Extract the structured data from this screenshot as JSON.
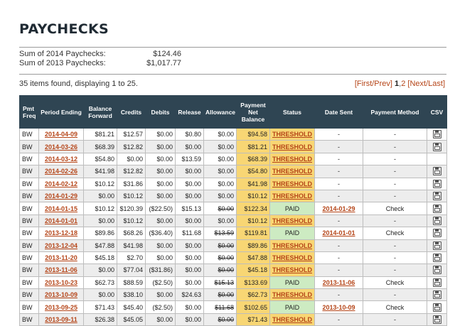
{
  "page_title": "PAYCHECKS",
  "sums": [
    {
      "label": "Sum of 2014 Paychecks:",
      "value": "$124.46"
    },
    {
      "label": "Sum of 2013 Paychecks:",
      "value": "$1,017.77"
    }
  ],
  "found_text": "35 items found, displaying 1 to 25.",
  "pager": {
    "first_prev": "[First/Prev]",
    "current": "1",
    "sep": ",",
    "page2": "2",
    "next_last": "[Next/Last]"
  },
  "columns": [
    "Pmt Freq",
    "Period Ending",
    "Balance Forward",
    "Credits",
    "Debits",
    "Release",
    "Allowance",
    "Payment Net Balance",
    "Status",
    "Date Sent",
    "Payment Method",
    "CSV"
  ],
  "rows": [
    {
      "freq": "BW",
      "period": "2014-04-09",
      "balance": "$81.21",
      "credits": "$12.57",
      "debits": "$0.00",
      "release": "$0.80",
      "allowance": "$0.00",
      "allow_strike": false,
      "net": "$94.58",
      "status": "THRESHOLD",
      "sent": "-",
      "sent_link": false,
      "method": "-",
      "csv": true
    },
    {
      "freq": "BW",
      "period": "2014-03-26",
      "balance": "$68.39",
      "credits": "$12.82",
      "debits": "$0.00",
      "release": "$0.00",
      "allowance": "$0.00",
      "allow_strike": false,
      "net": "$81.21",
      "status": "THRESHOLD",
      "sent": "-",
      "sent_link": false,
      "method": "-",
      "csv": true
    },
    {
      "freq": "BW",
      "period": "2014-03-12",
      "balance": "$54.80",
      "credits": "$0.00",
      "debits": "$0.00",
      "release": "$13.59",
      "allowance": "$0.00",
      "allow_strike": false,
      "net": "$68.39",
      "status": "THRESHOLD",
      "sent": "-",
      "sent_link": false,
      "method": "-",
      "csv": false
    },
    {
      "freq": "BW",
      "period": "2014-02-26",
      "balance": "$41.98",
      "credits": "$12.82",
      "debits": "$0.00",
      "release": "$0.00",
      "allowance": "$0.00",
      "allow_strike": false,
      "net": "$54.80",
      "status": "THRESHOLD",
      "sent": "-",
      "sent_link": false,
      "method": "-",
      "csv": true
    },
    {
      "freq": "BW",
      "period": "2014-02-12",
      "balance": "$10.12",
      "credits": "$31.86",
      "debits": "$0.00",
      "release": "$0.00",
      "allowance": "$0.00",
      "allow_strike": false,
      "net": "$41.98",
      "status": "THRESHOLD",
      "sent": "-",
      "sent_link": false,
      "method": "-",
      "csv": true
    },
    {
      "freq": "BW",
      "period": "2014-01-29",
      "balance": "$0.00",
      "credits": "$10.12",
      "debits": "$0.00",
      "release": "$0.00",
      "allowance": "$0.00",
      "allow_strike": false,
      "net": "$10.12",
      "status": "THRESHOLD",
      "sent": "-",
      "sent_link": false,
      "method": "-",
      "csv": true
    },
    {
      "freq": "BW",
      "period": "2014-01-15",
      "balance": "$10.12",
      "credits": "$120.39",
      "debits": "($22.50)",
      "release": "$15.13",
      "allowance": "$0.00",
      "allow_strike": true,
      "net": "$122.34",
      "status": "PAID",
      "sent": "2014-01-29",
      "sent_link": true,
      "method": "Check",
      "csv": true
    },
    {
      "freq": "BW",
      "period": "2014-01-01",
      "balance": "$0.00",
      "credits": "$10.12",
      "debits": "$0.00",
      "release": "$0.00",
      "allowance": "$0.00",
      "allow_strike": false,
      "net": "$10.12",
      "status": "THRESHOLD",
      "sent": "-",
      "sent_link": false,
      "method": "-",
      "csv": true
    },
    {
      "freq": "BW",
      "period": "2013-12-18",
      "balance": "$89.86",
      "credits": "$68.26",
      "debits": "($36.40)",
      "release": "$11.68",
      "allowance": "$13.59",
      "allow_strike": true,
      "net": "$119.81",
      "status": "PAID",
      "sent": "2014-01-01",
      "sent_link": true,
      "method": "Check",
      "csv": true
    },
    {
      "freq": "BW",
      "period": "2013-12-04",
      "balance": "$47.88",
      "credits": "$41.98",
      "debits": "$0.00",
      "release": "$0.00",
      "allowance": "$0.00",
      "allow_strike": true,
      "net": "$89.86",
      "status": "THRESHOLD",
      "sent": "-",
      "sent_link": false,
      "method": "-",
      "csv": true
    },
    {
      "freq": "BW",
      "period": "2013-11-20",
      "balance": "$45.18",
      "credits": "$2.70",
      "debits": "$0.00",
      "release": "$0.00",
      "allowance": "$0.00",
      "allow_strike": true,
      "net": "$47.88",
      "status": "THRESHOLD",
      "sent": "-",
      "sent_link": false,
      "method": "-",
      "csv": true
    },
    {
      "freq": "BW",
      "period": "2013-11-06",
      "balance": "$0.00",
      "credits": "$77.04",
      "debits": "($31.86)",
      "release": "$0.00",
      "allowance": "$0.00",
      "allow_strike": true,
      "net": "$45.18",
      "status": "THRESHOLD",
      "sent": "-",
      "sent_link": false,
      "method": "-",
      "csv": true
    },
    {
      "freq": "BW",
      "period": "2013-10-23",
      "balance": "$62.73",
      "credits": "$88.59",
      "debits": "($2.50)",
      "release": "$0.00",
      "allowance": "$15.13",
      "allow_strike": true,
      "net": "$133.69",
      "status": "PAID",
      "sent": "2013-11-06",
      "sent_link": true,
      "method": "Check",
      "csv": true
    },
    {
      "freq": "BW",
      "period": "2013-10-09",
      "balance": "$0.00",
      "credits": "$38.10",
      "debits": "$0.00",
      "release": "$24.63",
      "allowance": "$0.00",
      "allow_strike": true,
      "net": "$62.73",
      "status": "THRESHOLD",
      "sent": "-",
      "sent_link": false,
      "method": "-",
      "csv": true
    },
    {
      "freq": "BW",
      "period": "2013-09-25",
      "balance": "$71.43",
      "credits": "$45.40",
      "debits": "($2.50)",
      "release": "$0.00",
      "allowance": "$11.68",
      "allow_strike": true,
      "net": "$102.65",
      "status": "PAID",
      "sent": "2013-10-09",
      "sent_link": true,
      "method": "Check",
      "csv": true
    },
    {
      "freq": "BW",
      "period": "2013-09-11",
      "balance": "$26.38",
      "credits": "$45.05",
      "debits": "$0.00",
      "release": "$0.00",
      "allowance": "$0.00",
      "allow_strike": true,
      "net": "$71.43",
      "status": "THRESHOLD",
      "sent": "-",
      "sent_link": false,
      "method": "-",
      "csv": true
    }
  ]
}
